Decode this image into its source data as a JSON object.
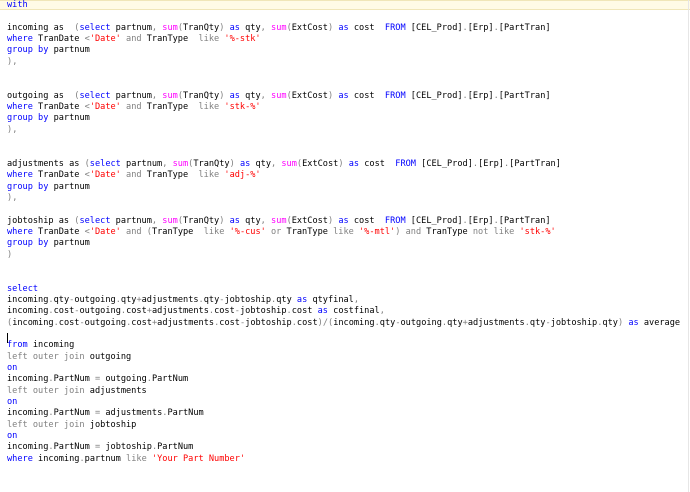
{
  "editor": {
    "lines": [
      [
        {
          "t": "with",
          "c": "kw"
        }
      ],
      [],
      [
        {
          "t": "incoming as  ",
          "c": ""
        },
        {
          "t": "(",
          "c": "gy"
        },
        {
          "t": "select",
          "c": "kw"
        },
        {
          "t": " partnum",
          "c": ""
        },
        {
          "t": ",",
          "c": "gy"
        },
        {
          "t": " ",
          "c": ""
        },
        {
          "t": "sum",
          "c": "fn"
        },
        {
          "t": "(",
          "c": "gy"
        },
        {
          "t": "TranQty",
          "c": ""
        },
        {
          "t": ")",
          "c": "gy"
        },
        {
          "t": " ",
          "c": ""
        },
        {
          "t": "as",
          "c": "kw"
        },
        {
          "t": " qty",
          "c": ""
        },
        {
          "t": ",",
          "c": "gy"
        },
        {
          "t": " ",
          "c": ""
        },
        {
          "t": "sum",
          "c": "fn"
        },
        {
          "t": "(",
          "c": "gy"
        },
        {
          "t": "ExtCost",
          "c": ""
        },
        {
          "t": ")",
          "c": "gy"
        },
        {
          "t": " ",
          "c": ""
        },
        {
          "t": "as",
          "c": "kw"
        },
        {
          "t": " cost  ",
          "c": ""
        },
        {
          "t": "FROM",
          "c": "kw"
        },
        {
          "t": " [CEL_Prod]",
          "c": ""
        },
        {
          "t": ".",
          "c": "gy"
        },
        {
          "t": "[Erp]",
          "c": ""
        },
        {
          "t": ".",
          "c": "gy"
        },
        {
          "t": "[PartTran]",
          "c": ""
        }
      ],
      [
        {
          "t": "where",
          "c": "kw"
        },
        {
          "t": " TranDate ",
          "c": ""
        },
        {
          "t": "<",
          "c": "gy"
        },
        {
          "t": "'Date'",
          "c": "str"
        },
        {
          "t": " ",
          "c": ""
        },
        {
          "t": "and",
          "c": "gy"
        },
        {
          "t": " TranType  ",
          "c": ""
        },
        {
          "t": "like",
          "c": "gy"
        },
        {
          "t": " ",
          "c": ""
        },
        {
          "t": "'%-stk'",
          "c": "str"
        }
      ],
      [
        {
          "t": "group by",
          "c": "kw"
        },
        {
          "t": " partnum",
          "c": ""
        }
      ],
      [
        {
          "t": ")",
          "c": "gy"
        },
        {
          "t": ",",
          "c": "gy"
        }
      ],
      [],
      [],
      [
        {
          "t": "outgoing as  ",
          "c": ""
        },
        {
          "t": "(",
          "c": "gy"
        },
        {
          "t": "select",
          "c": "kw"
        },
        {
          "t": " partnum",
          "c": ""
        },
        {
          "t": ",",
          "c": "gy"
        },
        {
          "t": " ",
          "c": ""
        },
        {
          "t": "sum",
          "c": "fn"
        },
        {
          "t": "(",
          "c": "gy"
        },
        {
          "t": "TranQty",
          "c": ""
        },
        {
          "t": ")",
          "c": "gy"
        },
        {
          "t": " ",
          "c": ""
        },
        {
          "t": "as",
          "c": "kw"
        },
        {
          "t": " qty",
          "c": ""
        },
        {
          "t": ",",
          "c": "gy"
        },
        {
          "t": " ",
          "c": ""
        },
        {
          "t": "sum",
          "c": "fn"
        },
        {
          "t": "(",
          "c": "gy"
        },
        {
          "t": "ExtCost",
          "c": ""
        },
        {
          "t": ")",
          "c": "gy"
        },
        {
          "t": " ",
          "c": ""
        },
        {
          "t": "as",
          "c": "kw"
        },
        {
          "t": " cost  ",
          "c": ""
        },
        {
          "t": "FROM",
          "c": "kw"
        },
        {
          "t": " [CEL_Prod]",
          "c": ""
        },
        {
          "t": ".",
          "c": "gy"
        },
        {
          "t": "[Erp]",
          "c": ""
        },
        {
          "t": ".",
          "c": "gy"
        },
        {
          "t": "[PartTran]",
          "c": ""
        }
      ],
      [
        {
          "t": "where",
          "c": "kw"
        },
        {
          "t": " TranDate ",
          "c": ""
        },
        {
          "t": "<",
          "c": "gy"
        },
        {
          "t": "'Date'",
          "c": "str"
        },
        {
          "t": " ",
          "c": ""
        },
        {
          "t": "and",
          "c": "gy"
        },
        {
          "t": " TranType  ",
          "c": ""
        },
        {
          "t": "like",
          "c": "gy"
        },
        {
          "t": " ",
          "c": ""
        },
        {
          "t": "'stk-%'",
          "c": "str"
        }
      ],
      [
        {
          "t": "group by",
          "c": "kw"
        },
        {
          "t": " partnum",
          "c": ""
        }
      ],
      [
        {
          "t": ")",
          "c": "gy"
        },
        {
          "t": ",",
          "c": "gy"
        }
      ],
      [],
      [],
      [
        {
          "t": "adjustments as ",
          "c": ""
        },
        {
          "t": "(",
          "c": "gy"
        },
        {
          "t": "select",
          "c": "kw"
        },
        {
          "t": " partnum",
          "c": ""
        },
        {
          "t": ",",
          "c": "gy"
        },
        {
          "t": " ",
          "c": ""
        },
        {
          "t": "sum",
          "c": "fn"
        },
        {
          "t": "(",
          "c": "gy"
        },
        {
          "t": "TranQty",
          "c": ""
        },
        {
          "t": ")",
          "c": "gy"
        },
        {
          "t": " ",
          "c": ""
        },
        {
          "t": "as",
          "c": "kw"
        },
        {
          "t": " qty",
          "c": ""
        },
        {
          "t": ",",
          "c": "gy"
        },
        {
          "t": " ",
          "c": ""
        },
        {
          "t": "sum",
          "c": "fn"
        },
        {
          "t": "(",
          "c": "gy"
        },
        {
          "t": "ExtCost",
          "c": ""
        },
        {
          "t": ")",
          "c": "gy"
        },
        {
          "t": " ",
          "c": ""
        },
        {
          "t": "as",
          "c": "kw"
        },
        {
          "t": " cost  ",
          "c": ""
        },
        {
          "t": "FROM",
          "c": "kw"
        },
        {
          "t": " [CEL_Prod]",
          "c": ""
        },
        {
          "t": ".",
          "c": "gy"
        },
        {
          "t": "[Erp]",
          "c": ""
        },
        {
          "t": ".",
          "c": "gy"
        },
        {
          "t": "[PartTran]",
          "c": ""
        }
      ],
      [
        {
          "t": "where",
          "c": "kw"
        },
        {
          "t": " TranDate ",
          "c": ""
        },
        {
          "t": "<",
          "c": "gy"
        },
        {
          "t": "'Date'",
          "c": "str"
        },
        {
          "t": " ",
          "c": ""
        },
        {
          "t": "and",
          "c": "gy"
        },
        {
          "t": " TranType  ",
          "c": ""
        },
        {
          "t": "like",
          "c": "gy"
        },
        {
          "t": " ",
          "c": ""
        },
        {
          "t": "'adj-%'",
          "c": "str"
        }
      ],
      [
        {
          "t": "group by",
          "c": "kw"
        },
        {
          "t": " partnum",
          "c": ""
        }
      ],
      [
        {
          "t": ")",
          "c": "gy"
        },
        {
          "t": ",",
          "c": "gy"
        }
      ],
      [],
      [
        {
          "t": "jobtoship as ",
          "c": ""
        },
        {
          "t": "(",
          "c": "gy"
        },
        {
          "t": "select",
          "c": "kw"
        },
        {
          "t": " partnum",
          "c": ""
        },
        {
          "t": ",",
          "c": "gy"
        },
        {
          "t": " ",
          "c": ""
        },
        {
          "t": "sum",
          "c": "fn"
        },
        {
          "t": "(",
          "c": "gy"
        },
        {
          "t": "TranQty",
          "c": ""
        },
        {
          "t": ")",
          "c": "gy"
        },
        {
          "t": " ",
          "c": ""
        },
        {
          "t": "as",
          "c": "kw"
        },
        {
          "t": " qty",
          "c": ""
        },
        {
          "t": ",",
          "c": "gy"
        },
        {
          "t": " ",
          "c": ""
        },
        {
          "t": "sum",
          "c": "fn"
        },
        {
          "t": "(",
          "c": "gy"
        },
        {
          "t": "ExtCost",
          "c": ""
        },
        {
          "t": ")",
          "c": "gy"
        },
        {
          "t": " ",
          "c": ""
        },
        {
          "t": "as",
          "c": "kw"
        },
        {
          "t": " cost  ",
          "c": ""
        },
        {
          "t": "FROM",
          "c": "kw"
        },
        {
          "t": " [CEL_Prod]",
          "c": ""
        },
        {
          "t": ".",
          "c": "gy"
        },
        {
          "t": "[Erp]",
          "c": ""
        },
        {
          "t": ".",
          "c": "gy"
        },
        {
          "t": "[PartTran]",
          "c": ""
        }
      ],
      [
        {
          "t": "where",
          "c": "kw"
        },
        {
          "t": " TranDate ",
          "c": ""
        },
        {
          "t": "<",
          "c": "gy"
        },
        {
          "t": "'Date'",
          "c": "str"
        },
        {
          "t": " ",
          "c": ""
        },
        {
          "t": "and",
          "c": "gy"
        },
        {
          "t": " ",
          "c": ""
        },
        {
          "t": "(",
          "c": "gy"
        },
        {
          "t": "TranType  ",
          "c": ""
        },
        {
          "t": "like",
          "c": "gy"
        },
        {
          "t": " ",
          "c": ""
        },
        {
          "t": "'%-cus'",
          "c": "str"
        },
        {
          "t": " ",
          "c": ""
        },
        {
          "t": "or",
          "c": "gy"
        },
        {
          "t": " TranType ",
          "c": ""
        },
        {
          "t": "like",
          "c": "gy"
        },
        {
          "t": " ",
          "c": ""
        },
        {
          "t": "'%-mtl'",
          "c": "str"
        },
        {
          "t": ")",
          "c": "gy"
        },
        {
          "t": " ",
          "c": ""
        },
        {
          "t": "and",
          "c": "gy"
        },
        {
          "t": " TranType ",
          "c": ""
        },
        {
          "t": "not",
          "c": "gy"
        },
        {
          "t": " ",
          "c": ""
        },
        {
          "t": "like",
          "c": "gy"
        },
        {
          "t": " ",
          "c": ""
        },
        {
          "t": "'stk-%'",
          "c": "str"
        }
      ],
      [
        {
          "t": "group by",
          "c": "kw"
        },
        {
          "t": " partnum",
          "c": ""
        }
      ],
      [
        {
          "t": ")",
          "c": "gy"
        }
      ],
      [],
      [],
      [
        {
          "t": "select",
          "c": "kw"
        }
      ],
      [
        {
          "t": "incoming",
          "c": ""
        },
        {
          "t": ".",
          "c": "gy"
        },
        {
          "t": "qty",
          "c": ""
        },
        {
          "t": "-",
          "c": "gy"
        },
        {
          "t": "outgoing",
          "c": ""
        },
        {
          "t": ".",
          "c": "gy"
        },
        {
          "t": "qty",
          "c": ""
        },
        {
          "t": "+",
          "c": "gy"
        },
        {
          "t": "adjustments",
          "c": ""
        },
        {
          "t": ".",
          "c": "gy"
        },
        {
          "t": "qty",
          "c": ""
        },
        {
          "t": "-",
          "c": "gy"
        },
        {
          "t": "jobtoship",
          "c": ""
        },
        {
          "t": ".",
          "c": "gy"
        },
        {
          "t": "qty ",
          "c": ""
        },
        {
          "t": "as",
          "c": "kw"
        },
        {
          "t": " qtyfinal",
          "c": ""
        },
        {
          "t": ",",
          "c": "gy"
        }
      ],
      [
        {
          "t": "incoming",
          "c": ""
        },
        {
          "t": ".",
          "c": "gy"
        },
        {
          "t": "cost",
          "c": ""
        },
        {
          "t": "-",
          "c": "gy"
        },
        {
          "t": "outgoing",
          "c": ""
        },
        {
          "t": ".",
          "c": "gy"
        },
        {
          "t": "cost",
          "c": ""
        },
        {
          "t": "+",
          "c": "gy"
        },
        {
          "t": "adjustments",
          "c": ""
        },
        {
          "t": ".",
          "c": "gy"
        },
        {
          "t": "cost",
          "c": ""
        },
        {
          "t": "-",
          "c": "gy"
        },
        {
          "t": "jobtoship",
          "c": ""
        },
        {
          "t": ".",
          "c": "gy"
        },
        {
          "t": "cost ",
          "c": ""
        },
        {
          "t": "as",
          "c": "kw"
        },
        {
          "t": " costfinal",
          "c": ""
        },
        {
          "t": ",",
          "c": "gy"
        }
      ],
      [
        {
          "t": "(",
          "c": "gy"
        },
        {
          "t": "incoming",
          "c": ""
        },
        {
          "t": ".",
          "c": "gy"
        },
        {
          "t": "cost",
          "c": ""
        },
        {
          "t": "-",
          "c": "gy"
        },
        {
          "t": "outgoing",
          "c": ""
        },
        {
          "t": ".",
          "c": "gy"
        },
        {
          "t": "cost",
          "c": ""
        },
        {
          "t": "+",
          "c": "gy"
        },
        {
          "t": "adjustments",
          "c": ""
        },
        {
          "t": ".",
          "c": "gy"
        },
        {
          "t": "cost",
          "c": ""
        },
        {
          "t": "-",
          "c": "gy"
        },
        {
          "t": "jobtoship",
          "c": ""
        },
        {
          "t": ".",
          "c": "gy"
        },
        {
          "t": "cost",
          "c": ""
        },
        {
          "t": ")",
          "c": "gy"
        },
        {
          "t": "/",
          "c": "gy"
        },
        {
          "t": "(",
          "c": "gy"
        },
        {
          "t": "incoming",
          "c": ""
        },
        {
          "t": ".",
          "c": "gy"
        },
        {
          "t": "qty",
          "c": ""
        },
        {
          "t": "-",
          "c": "gy"
        },
        {
          "t": "outgoing",
          "c": ""
        },
        {
          "t": ".",
          "c": "gy"
        },
        {
          "t": "qty",
          "c": ""
        },
        {
          "t": "+",
          "c": "gy"
        },
        {
          "t": "adjustments",
          "c": ""
        },
        {
          "t": ".",
          "c": "gy"
        },
        {
          "t": "qty",
          "c": ""
        },
        {
          "t": "-",
          "c": "gy"
        },
        {
          "t": "jobtoship",
          "c": ""
        },
        {
          "t": ".",
          "c": "gy"
        },
        {
          "t": "qty",
          "c": ""
        },
        {
          "t": ")",
          "c": "gy"
        },
        {
          "t": " ",
          "c": ""
        },
        {
          "t": "as",
          "c": "kw"
        },
        {
          "t": " average",
          "c": ""
        }
      ],
      [],
      [
        {
          "t": "from",
          "c": "kw"
        },
        {
          "t": " incoming",
          "c": ""
        }
      ],
      [
        {
          "t": "left outer join",
          "c": "gy"
        },
        {
          "t": " outgoing",
          "c": ""
        }
      ],
      [
        {
          "t": "on",
          "c": "kw"
        }
      ],
      [
        {
          "t": "incoming",
          "c": ""
        },
        {
          "t": ".",
          "c": "gy"
        },
        {
          "t": "PartNum ",
          "c": ""
        },
        {
          "t": "=",
          "c": "gy"
        },
        {
          "t": " outgoing",
          "c": ""
        },
        {
          "t": ".",
          "c": "gy"
        },
        {
          "t": "PartNum",
          "c": ""
        }
      ],
      [
        {
          "t": "left outer join",
          "c": "gy"
        },
        {
          "t": " adjustments",
          "c": ""
        }
      ],
      [
        {
          "t": "on",
          "c": "kw"
        }
      ],
      [
        {
          "t": "incoming",
          "c": ""
        },
        {
          "t": ".",
          "c": "gy"
        },
        {
          "t": "PartNum ",
          "c": ""
        },
        {
          "t": "=",
          "c": "gy"
        },
        {
          "t": " adjustments",
          "c": ""
        },
        {
          "t": ".",
          "c": "gy"
        },
        {
          "t": "PartNum",
          "c": ""
        }
      ],
      [
        {
          "t": "left outer join",
          "c": "gy"
        },
        {
          "t": " jobtoship",
          "c": ""
        }
      ],
      [
        {
          "t": "on",
          "c": "kw"
        }
      ],
      [
        {
          "t": "incoming",
          "c": ""
        },
        {
          "t": ".",
          "c": "gy"
        },
        {
          "t": "PartNum ",
          "c": ""
        },
        {
          "t": "=",
          "c": "gy"
        },
        {
          "t": " jobtoship",
          "c": ""
        },
        {
          "t": ".",
          "c": "gy"
        },
        {
          "t": "PartNum",
          "c": ""
        }
      ],
      [
        {
          "t": "where",
          "c": "kw"
        },
        {
          "t": " incoming",
          "c": ""
        },
        {
          "t": ".",
          "c": "gy"
        },
        {
          "t": "partnum ",
          "c": ""
        },
        {
          "t": "like",
          "c": "gy"
        },
        {
          "t": " ",
          "c": ""
        },
        {
          "t": "'Your Part Number'",
          "c": "str"
        }
      ]
    ]
  }
}
